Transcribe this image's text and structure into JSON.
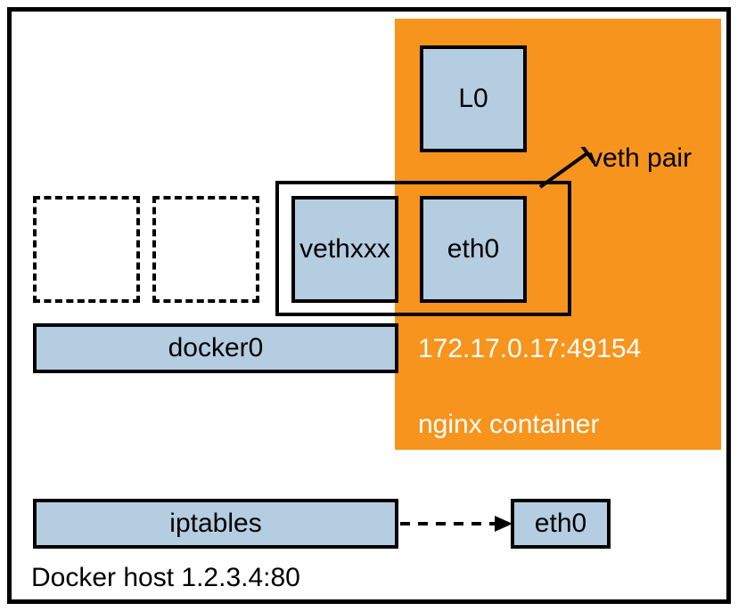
{
  "host": {
    "label": "Docker host 1.2.3.4:80"
  },
  "container": {
    "label": "nginx container",
    "ip": "172.17.0.17:49154"
  },
  "boxes": {
    "l0": "L0",
    "vethxxx": "vethxxx",
    "eth0_container": "eth0",
    "docker0": "docker0",
    "iptables": "iptables",
    "eth0_host": "eth0"
  },
  "labels": {
    "veth_pair": "veth pair"
  }
}
